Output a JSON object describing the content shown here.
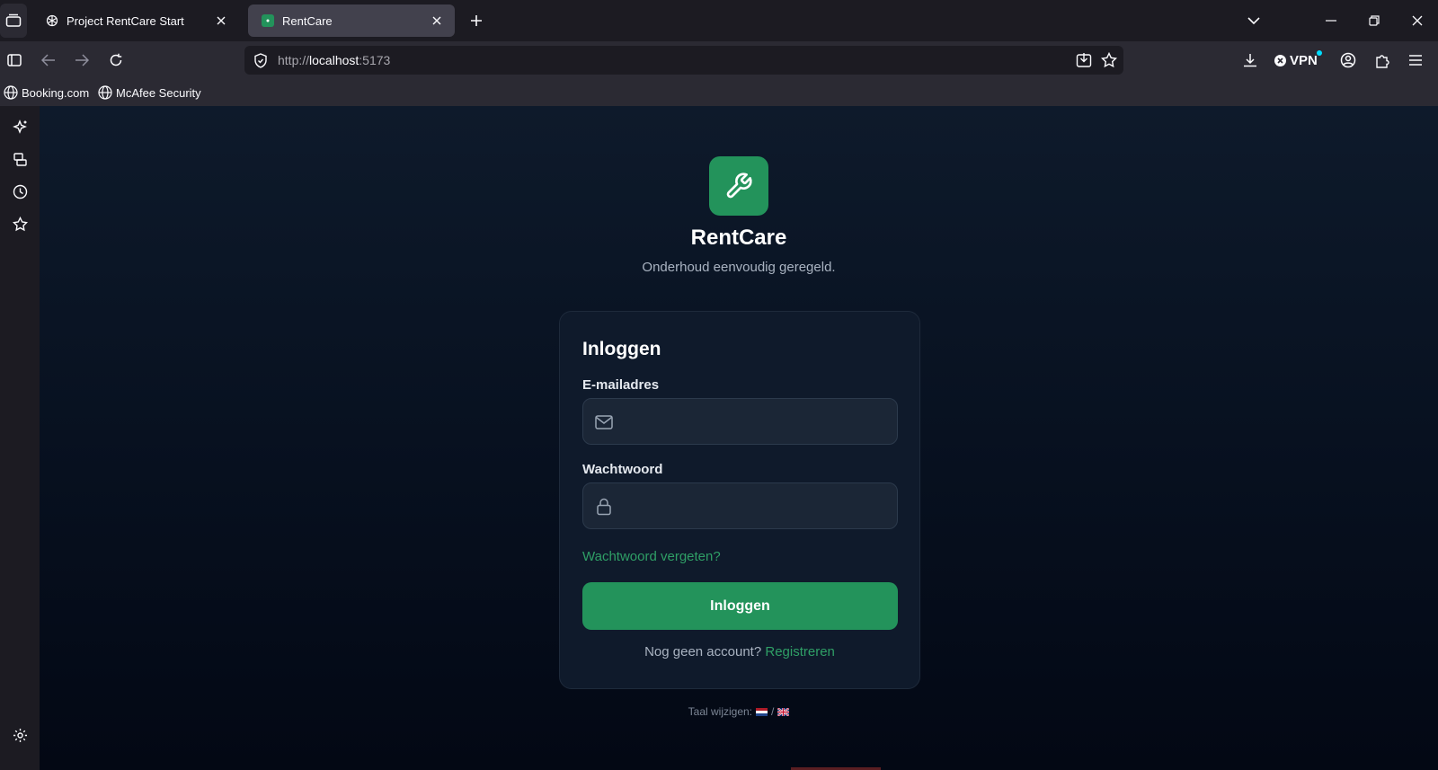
{
  "browser": {
    "tabs": [
      {
        "title": "Project RentCare Start",
        "active": false
      },
      {
        "title": "RentCare",
        "active": true
      }
    ],
    "url": {
      "scheme": "http://",
      "host": "localhost",
      "port": ":5173"
    },
    "vpn_label": "VPN",
    "bookmarks": [
      {
        "label": "Booking.com"
      },
      {
        "label": "McAfee Security"
      }
    ]
  },
  "app": {
    "brand": "RentCare",
    "tagline": "Onderhoud eenvoudig geregeld.",
    "accent_color": "#23935b",
    "login": {
      "title": "Inloggen",
      "email_label": "E-mailadres",
      "email_value": "",
      "password_label": "Wachtwoord",
      "password_value": "",
      "forgot_link": "Wachtwoord vergeten?",
      "submit_label": "Inloggen",
      "no_account_text": "Nog geen account?",
      "register_link": "Registreren"
    },
    "language": {
      "label": "Taal wijzigen:",
      "separator": "/",
      "options": [
        "nl-flag",
        "gb-flag"
      ]
    }
  }
}
